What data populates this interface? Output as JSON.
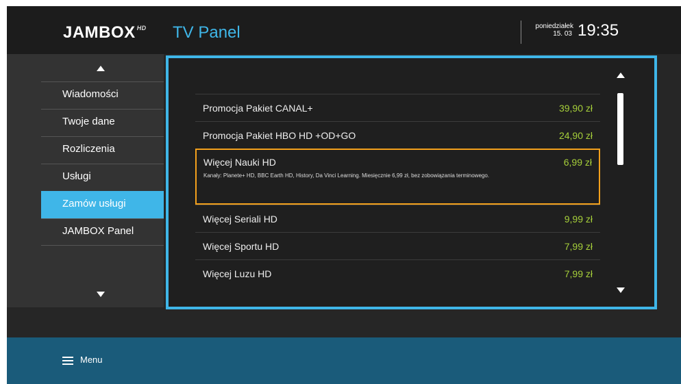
{
  "header": {
    "logo_text": "JAMBOX",
    "logo_suffix": "HD",
    "title": "TV Panel",
    "day": "poniedziałek",
    "date": "15. 03",
    "time": "19:35"
  },
  "sidebar": {
    "items": [
      {
        "label": "Wiadomości"
      },
      {
        "label": "Twoje dane"
      },
      {
        "label": "Rozliczenia"
      },
      {
        "label": "Usługi"
      },
      {
        "label": "Zamów usługi",
        "active": true
      },
      {
        "label": "JAMBOX Panel"
      }
    ]
  },
  "services": [
    {
      "name": "Promocja Pakiet CANAL+",
      "price": "39,90 zł"
    },
    {
      "name": "Promocja Pakiet HBO HD +OD+GO",
      "price": "24,90 zł"
    },
    {
      "name": "Więcej Nauki HD",
      "price": "6,99 zł",
      "selected": true,
      "description": "Kanały: Planete+ HD, BBC Earth HD, History, Da Vinci Learning. Miesięcznie 6,99 zł, bez zobowiązania terminowego."
    },
    {
      "name": "Więcej Seriali HD",
      "price": "9,99 zł"
    },
    {
      "name": "Więcej Sportu HD",
      "price": "7,99 zł"
    },
    {
      "name": "Więcej Luzu HD",
      "price": "7,99 zł"
    }
  ],
  "footer": {
    "menu_label": "Menu"
  },
  "colors": {
    "accent": "#3fb6e8",
    "selection": "#f4a11c",
    "price": "#a6cf3a",
    "footer": "#1a5b7a"
  },
  "icons": {
    "scroll_up": "triangle-up-icon",
    "scroll_down": "triangle-down-icon",
    "menu": "hamburger-icon"
  }
}
